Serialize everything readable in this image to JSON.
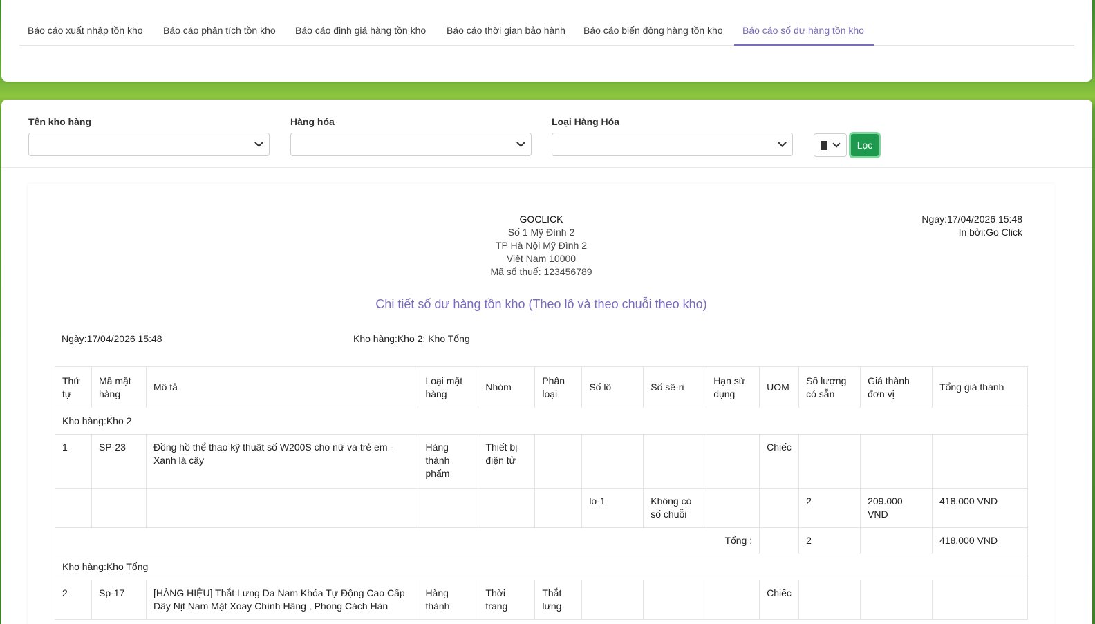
{
  "tabs": [
    {
      "label": "Báo cáo xuất nhập tồn kho"
    },
    {
      "label": "Báo cáo phân tích tồn kho"
    },
    {
      "label": "Báo cáo định giá hàng tồn kho"
    },
    {
      "label": "Báo cáo thời gian bảo hành"
    },
    {
      "label": "Báo cáo biến động hàng tồn kho"
    },
    {
      "label": "Báo cáo số dư hàng tồn kho"
    }
  ],
  "filters": {
    "warehouse_label": "Tên kho hàng",
    "goods_label": "Hàng hóa",
    "goods_type_label": "Loại Hàng Hóa",
    "filter_button": "Lọc"
  },
  "report": {
    "company": {
      "name": "GOCLICK",
      "address1": "Số 1 Mỹ Đình 2",
      "address2": "TP Hà Nội Mỹ Đình 2",
      "address3": "Việt Nam 10000",
      "tax": "Mã số thuế: 123456789"
    },
    "date_right": "Ngày:17/04/2026 15:48",
    "printed_by": "In bởi:Go Click",
    "title": "Chi tiết số dư hàng tồn kho (Theo lô và theo chuỗi theo kho)",
    "date": "Ngày:17/04/2026 15:48",
    "warehouses": "Kho hàng:Kho 2; Kho Tổng",
    "columns": [
      "Thứ tự",
      "Mã mặt hàng",
      "Mô tả",
      "Loại mặt hàng",
      "Nhóm",
      "Phân loại",
      "Số lô",
      "Số sê-ri",
      "Hạn sử dụng",
      "UOM",
      "Số lượng có sẵn",
      "Giá thành đơn vị",
      "Tổng giá thành"
    ],
    "group1": {
      "header": "Kho hàng:Kho 2",
      "item": {
        "no": "1",
        "code": "SP-23",
        "desc": "Đồng hồ thể thao kỹ thuật số W200S cho nữ và trẻ em - Xanh lá cây",
        "type": "Hàng thành phẩm",
        "group": "Thiết bị điện tử",
        "category": "",
        "uom": "Chiếc"
      },
      "lot": {
        "lot": "lo-1",
        "serial": "Không có số chuỗi",
        "qty": "2",
        "unit_price": "209.000 VND",
        "total": "418.000 VND"
      },
      "total_label": "Tổng :",
      "total_qty": "2",
      "total_value": "418.000 VND"
    },
    "group2": {
      "header": "Kho hàng:Kho Tổng",
      "item": {
        "no": "2",
        "code": "Sp-17",
        "desc": "[HÀNG HIỆU] Thắt Lưng Da Nam Khóa Tự Động Cao Cấp Dây Nịt Nam Mặt Xoay Chính Hãng , Phong Cách Hàn",
        "type": "Hàng thành",
        "group": "Thời trang",
        "category": "Thắt lưng",
        "uom": "Chiếc"
      }
    }
  }
}
